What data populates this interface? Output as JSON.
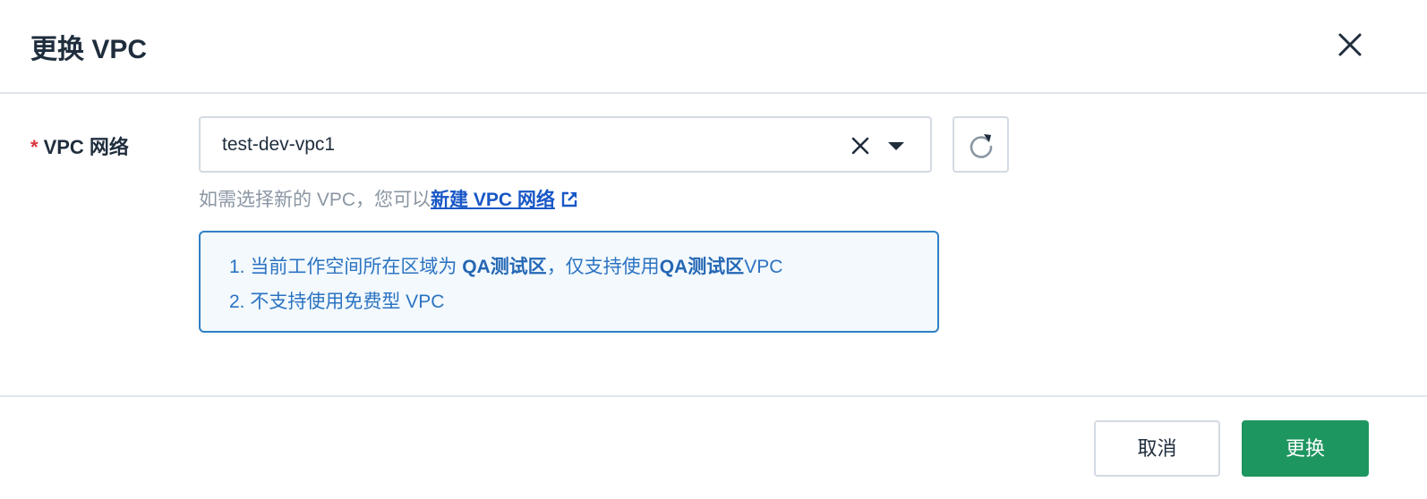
{
  "dialog": {
    "title": "更换 VPC"
  },
  "form": {
    "vpc_field": {
      "required_mark": "*",
      "label": "VPC 网络",
      "selected_value": "test-dev-vpc1"
    },
    "hint": {
      "text": "如需选择新的 VPC，您可以",
      "link_text": "新建 VPC 网络"
    },
    "notice": {
      "line1": {
        "prefix": "1. 当前工作空间所在区域为 ",
        "region1": "QA测试区",
        "middle": "，仅支持使用",
        "region2": "QA测试区",
        "suffix": "VPC"
      },
      "line2": "2. 不支持使用免费型 VPC"
    }
  },
  "footer": {
    "cancel_label": "取消",
    "confirm_label": "更换"
  },
  "icons": {
    "close": "close-icon",
    "clear": "clear-icon",
    "dropdown": "chevron-down-icon",
    "refresh": "refresh-icon",
    "external_link": "external-link-icon"
  },
  "colors": {
    "primary": "#1e9660",
    "link": "#1857c6",
    "notice_border": "#2f7fc7",
    "notice_bg": "#f3f9fd",
    "required": "#d9363e"
  }
}
